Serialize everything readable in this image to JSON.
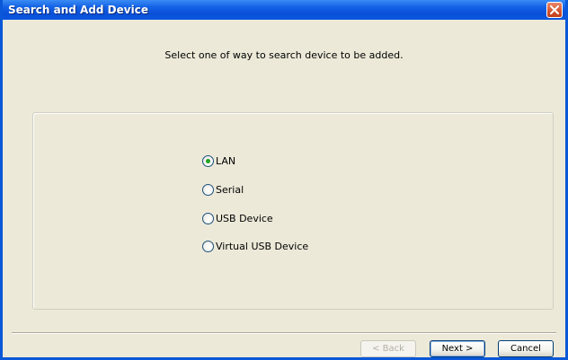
{
  "window": {
    "title": "Search and Add Device"
  },
  "instruction": "Select one of  way to search device to be added.",
  "options": [
    {
      "label": "LAN",
      "checked": true
    },
    {
      "label": "Serial",
      "checked": false
    },
    {
      "label": "USB Device",
      "checked": false
    },
    {
      "label": "Virtual USB Device",
      "checked": false
    }
  ],
  "buttons": {
    "back": {
      "label": "< Back",
      "enabled": false
    },
    "next": {
      "label": "Next >",
      "enabled": true
    },
    "cancel": {
      "label": "Cancel",
      "enabled": true
    }
  },
  "colors": {
    "titlebar": "#0a58d8",
    "window_bg": "#ece9d8",
    "radio_dot": "#21a121",
    "close_button": "#d6522b"
  },
  "icons": {
    "close": "close-icon",
    "radio": "radio-button-icon"
  }
}
